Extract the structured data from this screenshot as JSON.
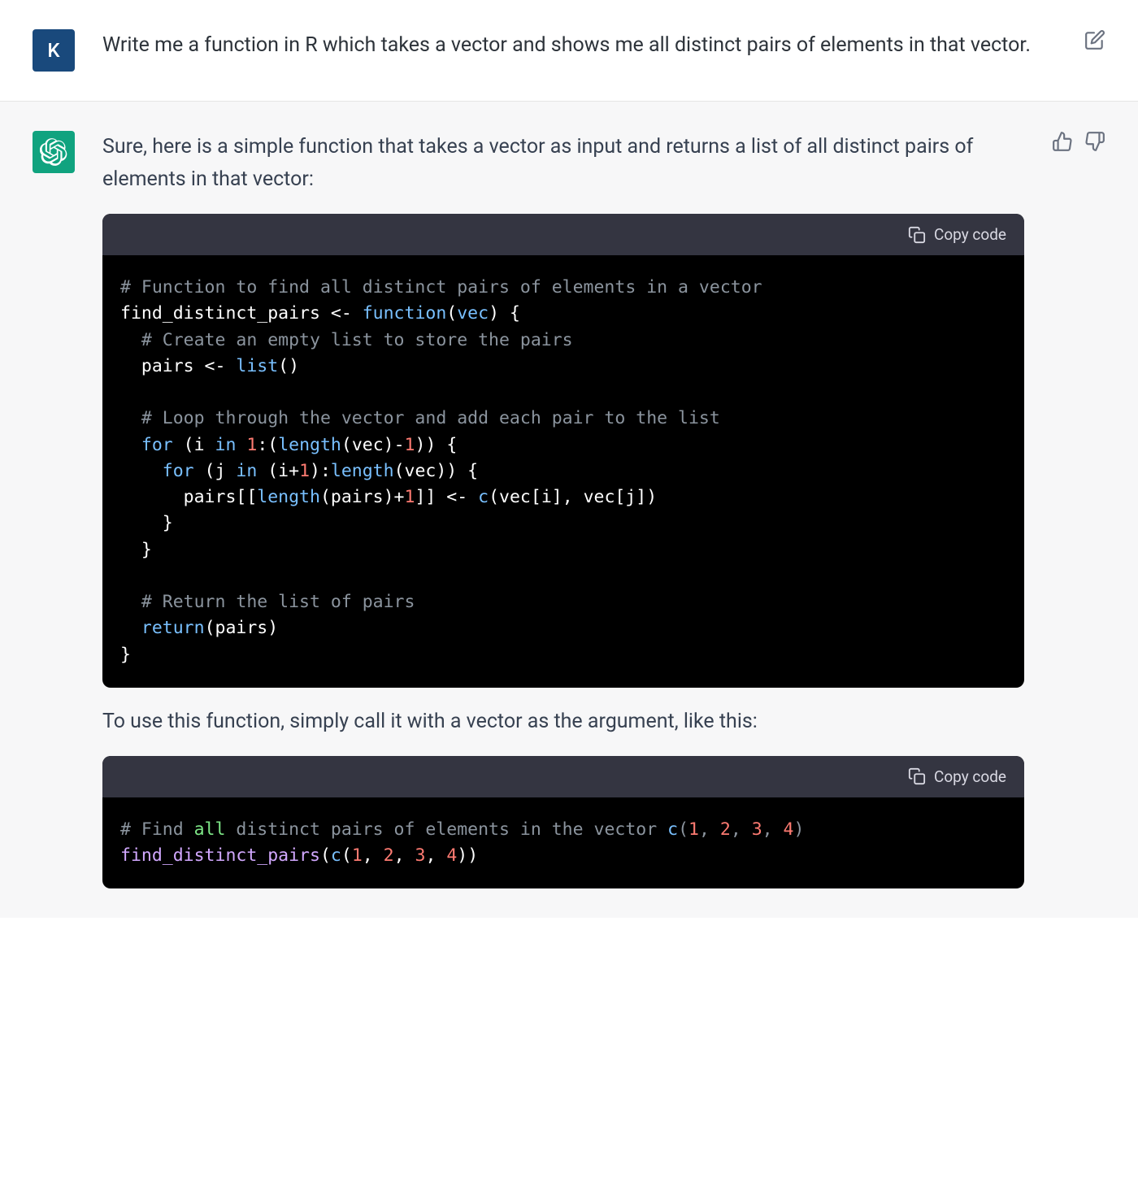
{
  "user": {
    "avatar_letter": "K",
    "message": "Write me a function in R which takes a vector and shows me all distinct pairs of elements in that vector."
  },
  "assistant": {
    "intro_text": "Sure, here is a simple function that takes a vector as input and returns a list of all distinct pairs of elements in that vector:",
    "mid_text": "To use this function, simply call it with a vector as the argument, like this:",
    "code_block_1": {
      "copy_label": "Copy code",
      "c1": "# Function to find all distinct pairs of elements in a vector",
      "l2a": "find_distinct_pairs <- ",
      "l2b": "function",
      "l2c": "(",
      "l2d": "vec",
      "l2e": ") {",
      "c3": "  # Create an empty list to store the pairs",
      "l4a": "  pairs <- ",
      "l4b": "list",
      "l4c": "()",
      "c6": "  # Loop through the vector and add each pair to the list",
      "l7a": "  for",
      "l7b": " (i ",
      "l7c": "in",
      "l7d": " ",
      "l7e": "1",
      "l7f": ":(",
      "l7g": "length",
      "l7h": "(vec)-",
      "l7i": "1",
      "l7j": ")) {",
      "l8a": "    for",
      "l8b": " (j ",
      "l8c": "in",
      "l8d": " (i+",
      "l8e": "1",
      "l8f": "):",
      "l8g": "length",
      "l8h": "(vec)) {",
      "l9a": "      pairs[[",
      "l9b": "length",
      "l9c": "(pairs)+",
      "l9d": "1",
      "l9e": "]] <- ",
      "l9f": "c",
      "l9g": "(vec[i], vec[j])",
      "l10": "    }",
      "l11": "  }",
      "c13": "  # Return the list of pairs",
      "l14a": "  return",
      "l14b": "(pairs)",
      "l15": "}"
    },
    "code_block_2": {
      "copy_label": "Copy code",
      "c1a": "# Find ",
      "c1b": "all",
      "c1c": " distinct pairs of elements in the vector ",
      "c1d": "c",
      "c1e": "(",
      "c1f": "1",
      "c1g": ", ",
      "c1h": "2",
      "c1i": ", ",
      "c1j": "3",
      "c1k": ", ",
      "c1l": "4",
      "c1m": ")",
      "l2a": "find_distinct_pairs",
      "l2b": "(",
      "l2c": "c",
      "l2d": "(",
      "l2e": "1",
      "l2f": ", ",
      "l2g": "2",
      "l2h": ", ",
      "l2i": "3",
      "l2j": ", ",
      "l2k": "4",
      "l2l": "))"
    }
  }
}
